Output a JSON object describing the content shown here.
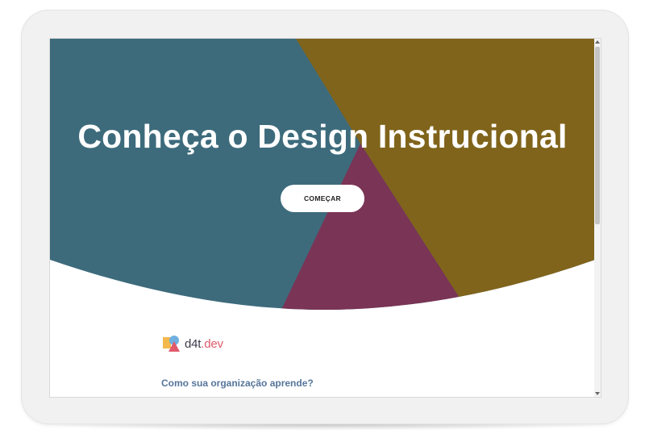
{
  "hero": {
    "title": "Conheça o Design Instrucional",
    "cta_label": "COMEÇAR",
    "colors": {
      "teal": "#3d6b7c",
      "gold": "#80641b",
      "magenta": "#7a3456"
    }
  },
  "brand": {
    "name_main": "d4t",
    "name_dot": ".",
    "name_suffix": "dev"
  },
  "section": {
    "question": "Como sua organização aprende?"
  },
  "icons": [
    "logo-mark-icon",
    "scroll-up-arrow-icon",
    "scroll-down-arrow-icon"
  ]
}
